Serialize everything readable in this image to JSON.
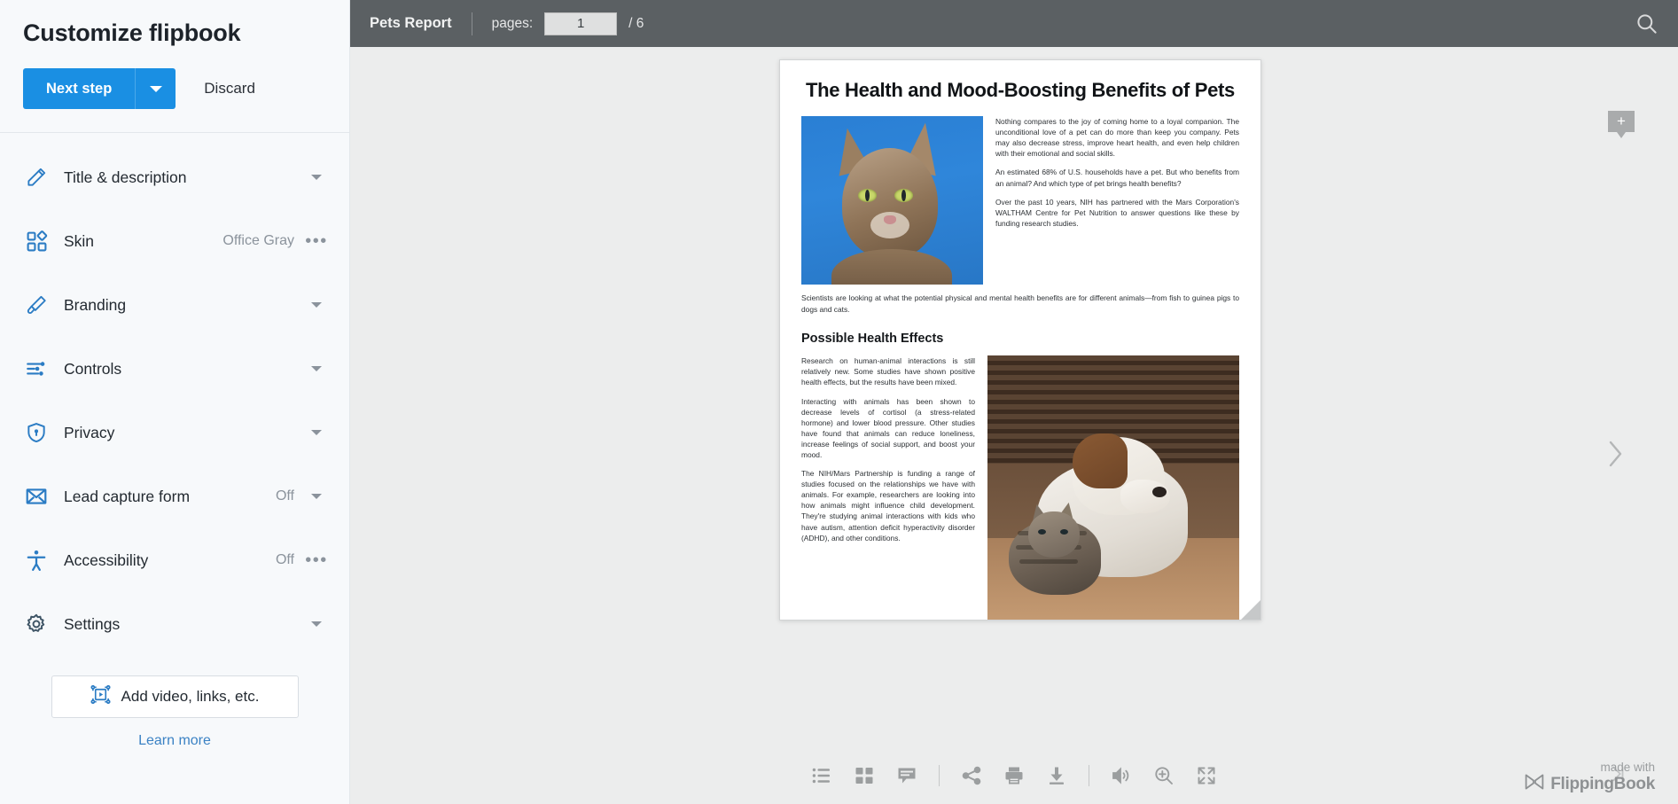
{
  "sidebar": {
    "title": "Customize flipbook",
    "next_step_label": "Next step",
    "discard_label": "Discard",
    "items": [
      {
        "label": "Title & description",
        "icon": "pencil-icon",
        "value": "",
        "trailing": "chevron"
      },
      {
        "label": "Skin",
        "icon": "grid-squares-icon",
        "value": "Office Gray",
        "trailing": "dots"
      },
      {
        "label": "Branding",
        "icon": "paintbrush-icon",
        "value": "",
        "trailing": "chevron"
      },
      {
        "label": "Controls",
        "icon": "sliders-icon",
        "value": "",
        "trailing": "chevron"
      },
      {
        "label": "Privacy",
        "icon": "shield-lock-icon",
        "value": "",
        "trailing": "chevron"
      },
      {
        "label": "Lead capture form",
        "icon": "envelope-icon",
        "value": "Off",
        "trailing": "chevron"
      },
      {
        "label": "Accessibility",
        "icon": "accessibility-icon",
        "value": "Off",
        "trailing": "dots"
      },
      {
        "label": "Settings",
        "icon": "gear-icon",
        "value": "",
        "trailing": "chevron"
      }
    ],
    "add_video_label": "Add video, links, etc.",
    "learn_more_label": "Learn more"
  },
  "topbar": {
    "doc_title": "Pets Report",
    "pages_label": "pages:",
    "current_page": "1",
    "page_total": "/ 6",
    "search_icon": "search-icon"
  },
  "page": {
    "title": "The Health and Mood-Boosting Benefits of Pets",
    "intro_paragraphs": [
      "Nothing compares to the joy of coming home to a loyal companion. The unconditional love of a pet can do more than keep you company. Pets may also decrease stress, improve heart health, and even help children with their emotional and social skills.",
      "An estimated 68% of U.S. households have a pet. But who benefits from an animal? And which type of pet brings health benefits?",
      "Over the past 10 years, NIH has partnered with the Mars Corporation's WALTHAM Centre for Pet Nutrition to answer questions like these by funding research studies."
    ],
    "wide_paragraph": "Scientists are looking at what the potential physical and mental health benefits are for different animals—from fish to guinea pigs to dogs and cats.",
    "section_heading": "Possible Health Effects",
    "section_paragraphs": [
      "Research on human-animal interactions is still relatively new. Some studies have shown positive health effects, but the results have been mixed.",
      "Interacting with animals has been shown to decrease levels of cortisol (a stress-related hormone) and lower blood pressure. Other studies have found that animals can reduce loneliness, increase feelings of social support, and boost your mood.",
      "The NIH/Mars Partnership is funding a range of studies focused on the relationships we have with animals. For example, researchers are looking into how animals might influence child development. They're studying animal interactions with kids who have autism, attention deficit hyperactivity disorder (ADHD), and other conditions."
    ]
  },
  "viewer_controls": {
    "add_marker_icon": "plus-badge-icon",
    "next_page_icon": "chevron-right-icon",
    "last_page_icon": "last-page-icon",
    "toolbar": [
      {
        "name": "contents-button",
        "icon": "list-icon"
      },
      {
        "name": "thumbnails-button",
        "icon": "grid-icon"
      },
      {
        "name": "notes-button",
        "icon": "note-icon"
      },
      {
        "name": "share-button",
        "icon": "share-icon"
      },
      {
        "name": "print-button",
        "icon": "printer-icon"
      },
      {
        "name": "download-button",
        "icon": "download-icon"
      },
      {
        "name": "sound-button",
        "icon": "sound-icon"
      },
      {
        "name": "zoom-button",
        "icon": "zoom-in-icon"
      },
      {
        "name": "fullscreen-button",
        "icon": "fullscreen-icon"
      }
    ]
  },
  "branding": {
    "made_with": "made with",
    "product": "FlippingBook"
  },
  "colors": {
    "accent_blue": "#1a8fe3",
    "icon_blue": "#2b7cc4",
    "topbar_gray": "#5b6063",
    "stage_gray": "#eceded",
    "sidebar_bg": "#f7f9fb"
  }
}
